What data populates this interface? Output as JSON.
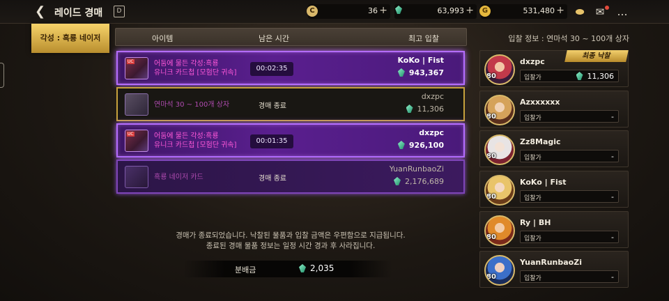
{
  "header": {
    "back_icon": "back-arrow-icon",
    "title": "레이드 경매",
    "calendar_label": "D",
    "currencies": [
      {
        "icon": "circle-coin-icon",
        "value": "36"
      },
      {
        "icon": "gem-icon",
        "value": "63,993"
      },
      {
        "icon": "gold-coin-icon",
        "value": "531,480"
      }
    ],
    "icons": [
      "inventory-icon",
      "mail-icon",
      "chat-icon"
    ]
  },
  "side_tab": {
    "label": "각성 : 흑룡 네이저"
  },
  "columns": {
    "item": "아이템",
    "time": "남은 시간",
    "top_bid": "최고 입찰"
  },
  "rows": [
    {
      "name_line1": "어둠에 물든 각성:흑룡",
      "name_line2": "유니크 카드첩 [모험단 귀속]",
      "time": "00:02:35",
      "bidder": "KoKo | Fist",
      "bid": "943,367"
    },
    {
      "name_line1": "연마석 30 ~ 100개 상자",
      "status": "경매 종료",
      "bidder": "dxzpc",
      "bid": "11,306"
    },
    {
      "name_line1": "어둠에 물든 각성:흑룡",
      "name_line2": "유니크 카드첩 [모험단 귀속]",
      "time": "00:01:35",
      "bidder": "dxzpc",
      "bid": "926,100"
    },
    {
      "name_line1": "흑룡 네이저 카드",
      "status": "경매 종료",
      "bidder": "YuanRunbaoZi",
      "bid": "2,176,689"
    }
  ],
  "notice": {
    "line1": "경매가 종료되었습니다. 낙찰된 물품과 입찰 금액은 우편함으로 지급됩니다.",
    "line2": "종료된 경매 물품 정보는 일정 시간 경과 후 사라집니다."
  },
  "distribution": {
    "label": "분배금",
    "amount": "2,035"
  },
  "bid_info": {
    "title": "입찰 정보 : 연마석 30 ~ 100개 상자",
    "final_badge": "최종 낙찰",
    "bid_label": "입찰가",
    "bidders": [
      {
        "name": "dxzpc",
        "level": "80",
        "amount": "11,306"
      },
      {
        "name": "Azxxxxxx",
        "level": "80",
        "amount": "-"
      },
      {
        "name": "Zz8Magic",
        "level": "80",
        "amount": "-"
      },
      {
        "name": "KoKo | Fist",
        "level": "80",
        "amount": "-"
      },
      {
        "name": "Ry | BH",
        "level": "80",
        "amount": "-"
      },
      {
        "name": "YuanRunbaoZi",
        "level": "80",
        "amount": "-"
      }
    ]
  }
}
